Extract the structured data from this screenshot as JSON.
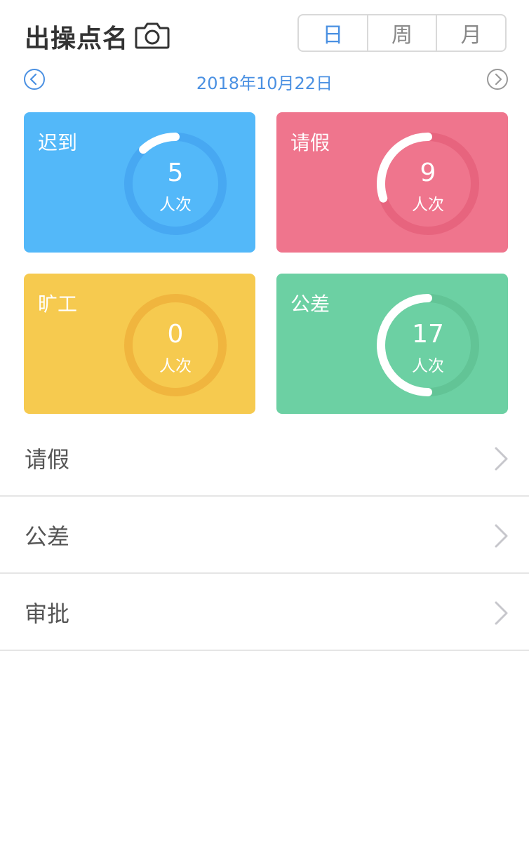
{
  "header": {
    "title": "出操点名",
    "camera_icon": "camera-icon"
  },
  "segments": [
    {
      "label": "日",
      "active": true
    },
    {
      "label": "周",
      "active": false
    },
    {
      "label": "月",
      "active": false
    }
  ],
  "date_nav": {
    "date": "2018年10月22日",
    "prev_icon": "chevron-left-circle-icon",
    "next_icon": "chevron-right-circle-icon"
  },
  "cards": [
    {
      "label": "迟到",
      "count": "5",
      "unit": "人次",
      "progress": 0.12,
      "bg": "#53b8f9",
      "track": "#47a8f2"
    },
    {
      "label": "请假",
      "count": "9",
      "unit": "人次",
      "progress": 0.3,
      "bg": "#ef758d",
      "track": "#e7647e"
    },
    {
      "label": "旷工",
      "count": "0",
      "unit": "人次",
      "progress": 0.0,
      "bg": "#f6ca4f",
      "track": "#f0b53e"
    },
    {
      "label": "公差",
      "count": "17",
      "unit": "人次",
      "progress": 0.5,
      "bg": "#6cd0a3",
      "track": "#62c496"
    }
  ],
  "list": [
    {
      "label": "请假"
    },
    {
      "label": "公差"
    },
    {
      "label": "审批"
    }
  ],
  "colors": {
    "accent": "#4a90e2",
    "divider": "#e5e5e5"
  }
}
